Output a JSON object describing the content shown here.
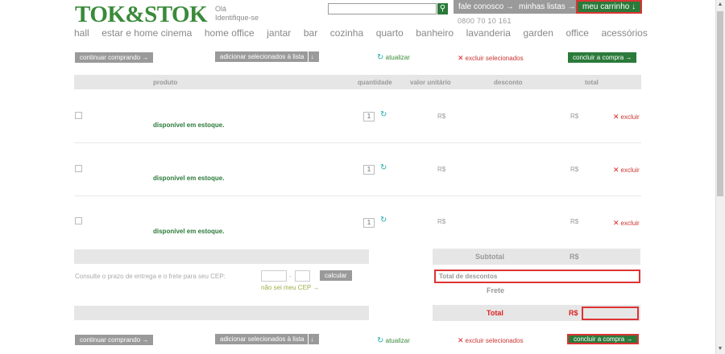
{
  "header": {
    "logo": "TOK&STOK",
    "greeting": "Olá",
    "identify": "Identifique-se",
    "search_placeholder": "",
    "fale_conosco": "fale conosco →",
    "minhas_listas": "minhas listas →",
    "meu_carrinho": "meu carrinho ↓",
    "phone": "0800 70 10 161"
  },
  "nav": [
    "hall",
    "estar e home cinema",
    "home office",
    "jantar",
    "bar",
    "cozinha",
    "quarto",
    "banheiro",
    "lavanderia",
    "garden",
    "office",
    "acessórios"
  ],
  "toolbar": {
    "continuar": "continuar comprando",
    "adicionar": "adicionar selecionados à lista",
    "atualizar": "atualizar",
    "excluir_sel": "excluir selecionados",
    "concluir": "concluir a compra"
  },
  "table": {
    "headers": [
      "produto",
      "quantidade",
      "valor unitário",
      "desconto",
      "total"
    ],
    "rows": [
      {
        "stock": "disponível em estoque.",
        "qty": "1",
        "unit": "R$",
        "total": "R$",
        "remove": "excluir"
      },
      {
        "stock": "disponível em estoque.",
        "qty": "1",
        "unit": "R$",
        "total": "R$",
        "remove": "excluir"
      },
      {
        "stock": "disponível em estoque.",
        "qty": "1",
        "unit": "R$",
        "total": "R$",
        "remove": "excluir"
      }
    ]
  },
  "summary": {
    "subtotal": "Subtotal",
    "subtotal_value": "R$",
    "descontos": "Total de descontos",
    "frete": "Frete",
    "total": "Total",
    "total_value": "R$"
  },
  "cep": {
    "label": "Consulte o prazo de entrega e o frete para seu CEP:",
    "dash": "-",
    "calcular": "calcular",
    "nao_sei": "não sei meu CEP"
  }
}
